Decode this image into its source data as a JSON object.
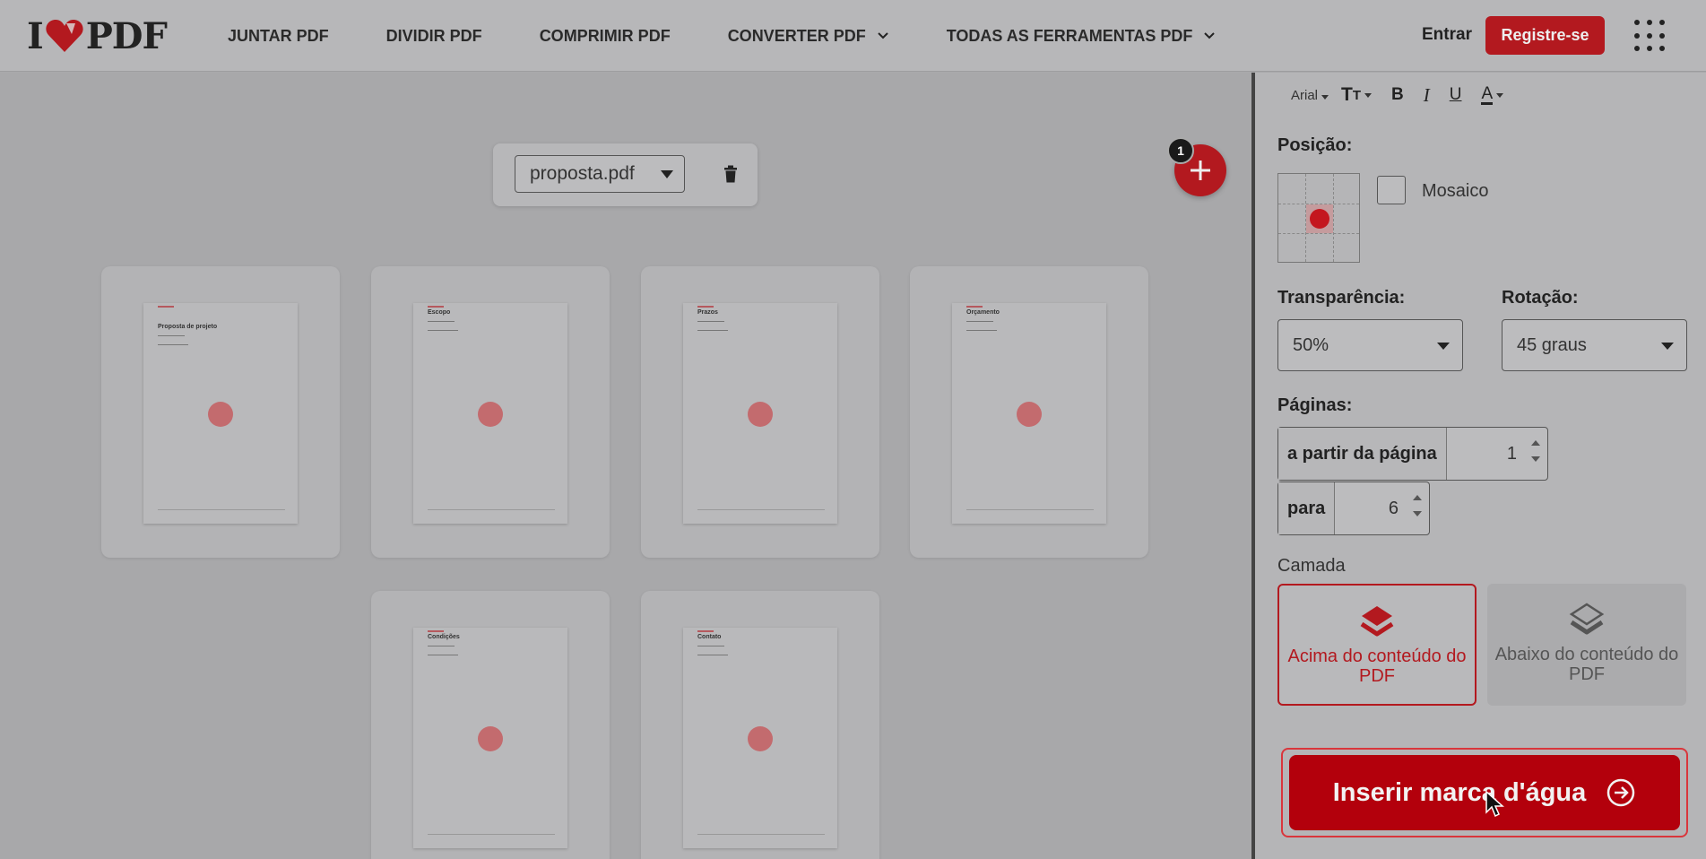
{
  "header": {
    "logo_left": "I",
    "logo_right": "PDF",
    "nav": [
      {
        "label": "JUNTAR PDF",
        "dropdown": false
      },
      {
        "label": "DIVIDIR PDF",
        "dropdown": false
      },
      {
        "label": "COMPRIMIR PDF",
        "dropdown": false
      },
      {
        "label": "CONVERTER PDF",
        "dropdown": true
      },
      {
        "label": "TODAS AS FERRAMENTAS PDF",
        "dropdown": true
      }
    ],
    "login": "Entrar",
    "register": "Registre-se"
  },
  "main": {
    "file_name": "proposta.pdf",
    "file_count_badge": "1",
    "pages": [
      {
        "title": "Proposta de projeto"
      },
      {
        "title": "Escopo"
      },
      {
        "title": "Prazos"
      },
      {
        "title": "Orçamento"
      },
      {
        "title": "Condições"
      },
      {
        "title": "Contato"
      }
    ]
  },
  "sidebar": {
    "font": "Arial",
    "position_label": "Posição:",
    "mosaic_label": "Mosaico",
    "transparency_label": "Transparência:",
    "transparency_value": "50%",
    "rotation_label": "Rotação:",
    "rotation_value": "45 graus",
    "pages_label": "Páginas:",
    "from_label": "a partir da página",
    "from_value": "1",
    "to_label": "para",
    "to_value": "6",
    "layer_label": "Camada",
    "layer_above": "Acima do conteúdo do PDF",
    "layer_below": "Abaixo do conteúdo do PDF",
    "submit": "Inserir marca d'água"
  },
  "colors": {
    "brand_red": "#b3191f",
    "overlay_gray": "#a8a8aa"
  }
}
